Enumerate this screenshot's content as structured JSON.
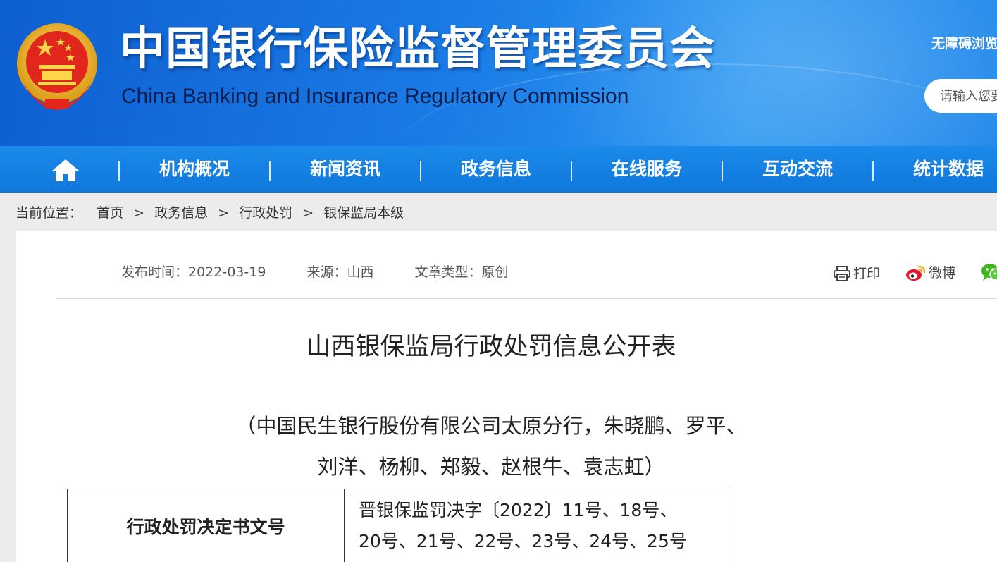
{
  "header": {
    "title_cn": "中国银行保险监督管理委员会",
    "title_en": "China Banking and Insurance Regulatory Commission",
    "accessibility_link": "无障碍浏览",
    "search_placeholder": "请输入您要搜索的内容",
    "brand_color": "#1a7be6",
    "emblem_icon": "national-emblem-icon"
  },
  "nav": {
    "home_icon": "home-icon",
    "items": [
      {
        "label": "机构概况"
      },
      {
        "label": "新闻资讯"
      },
      {
        "label": "政务信息"
      },
      {
        "label": "在线服务"
      },
      {
        "label": "互动交流"
      },
      {
        "label": "统计数据"
      }
    ]
  },
  "breadcrumb": {
    "label": "当前位置：",
    "items": [
      "首页",
      "政务信息",
      "行政处罚",
      "银保监局本级"
    ],
    "separator": ">"
  },
  "article": {
    "meta": {
      "publish_time": "发布时间：2022-03-19",
      "source": "来源：山西",
      "type": "文章类型：原创"
    },
    "share": {
      "print": "打印",
      "weibo": "微博",
      "wechat": "微信"
    },
    "title": "山西银保监局行政处罚信息公开表",
    "subtitle_lines": [
      "（中国民生银行股份有限公司太原分行，朱晓鹏、罗平、",
      "刘洋、杨柳、郑毅、赵根牛、袁志虹）"
    ],
    "table": {
      "header": "行政处罚决定书文号",
      "value_lines": [
        "晋银保监罚决字〔2022〕11号、18号、",
        "20号、21号、22号、23号、24号、25号"
      ]
    }
  }
}
